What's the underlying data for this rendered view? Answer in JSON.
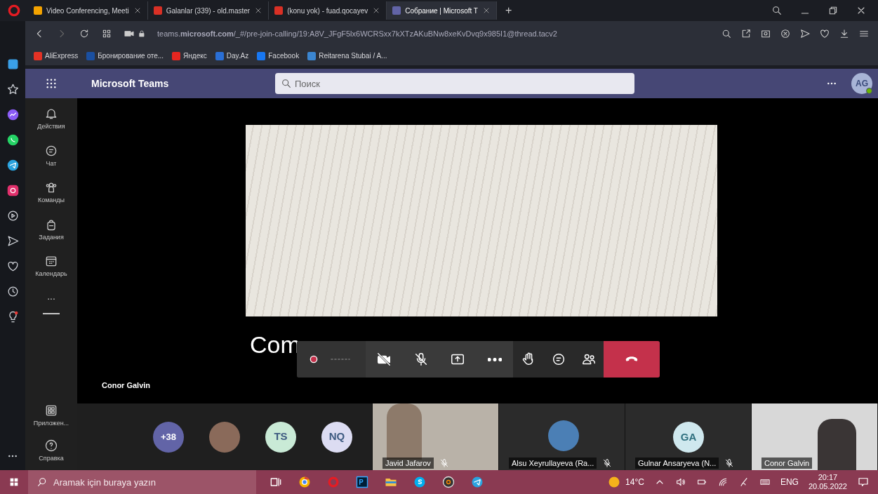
{
  "browser": {
    "tabs": [
      {
        "label": "Video Conferencing, Meeti",
        "selected": false,
        "color": "#f4a300"
      },
      {
        "label": "Galanlar (339) - old.master",
        "selected": false,
        "color": "#d93025"
      },
      {
        "label": "(konu yok) - fuad.qocayev",
        "selected": false,
        "color": "#d93025"
      },
      {
        "label": "Собрание | Microsoft T",
        "selected": true,
        "color": "#6264a7"
      }
    ],
    "new_tab": "+",
    "url": "teams.**microsoft.com**/_#/pre-join-calling/19:A8V_JFgF5lx6WCRSxx7kXTzAKuBNw8xeKvDvq9x985I1@thread.tacv2",
    "bookmarks": [
      {
        "label": "AliExpress",
        "color": "#e43225"
      },
      {
        "label": "Бронирование оте...",
        "color": "#1a4fa0"
      },
      {
        "label": "Яндекс",
        "color": "#e52620"
      },
      {
        "label": "Day.Az",
        "color": "#2a6fd6"
      },
      {
        "label": "Facebook",
        "color": "#1877f2"
      },
      {
        "label": "Reitarena Stubai / A...",
        "color": "#3b86d1"
      }
    ]
  },
  "teams": {
    "app_name": "Microsoft Teams",
    "search_placeholder": "Поиск",
    "avatar": "AG",
    "rail": [
      {
        "kind": "bell",
        "label": "Действия"
      },
      {
        "kind": "chat",
        "label": "Чат"
      },
      {
        "kind": "people",
        "label": "Команды"
      },
      {
        "kind": "bag",
        "label": "Задания"
      },
      {
        "kind": "calendar",
        "label": "Календарь"
      }
    ],
    "more": "...",
    "rail_bottom": [
      {
        "kind": "apps",
        "label": "Приложен..."
      },
      {
        "kind": "help",
        "label": "Справка"
      }
    ]
  },
  "stage": {
    "slide_title": "Com",
    "presenter": "Conor Galvin"
  },
  "participants": [
    {
      "kind": "count",
      "label": "+38",
      "color": "#6264a7"
    },
    {
      "kind": "photo"
    },
    {
      "kind": "initials",
      "label": "TS",
      "color": "#c9ead6"
    },
    {
      "kind": "initials",
      "label": "NQ",
      "color": "#dcdcf2"
    }
  ],
  "tiles": [
    {
      "kind": "video",
      "name": "Javid Jafarov",
      "muted": true
    },
    {
      "kind": "avatar",
      "name": "Alsu Xeyrullayeva (Ra...",
      "muted": true
    },
    {
      "kind": "initials",
      "initials": "GA",
      "name": "Gulnar Ansaryeva (N...",
      "muted": true
    },
    {
      "kind": "video",
      "name": "Conor Galvin",
      "muted": false
    }
  ],
  "taskbar": {
    "search_placeholder": "Aramak için buraya yazın",
    "temperature": "14°C",
    "language": "ENG",
    "time": "20:17",
    "date": "20.05.2022"
  }
}
